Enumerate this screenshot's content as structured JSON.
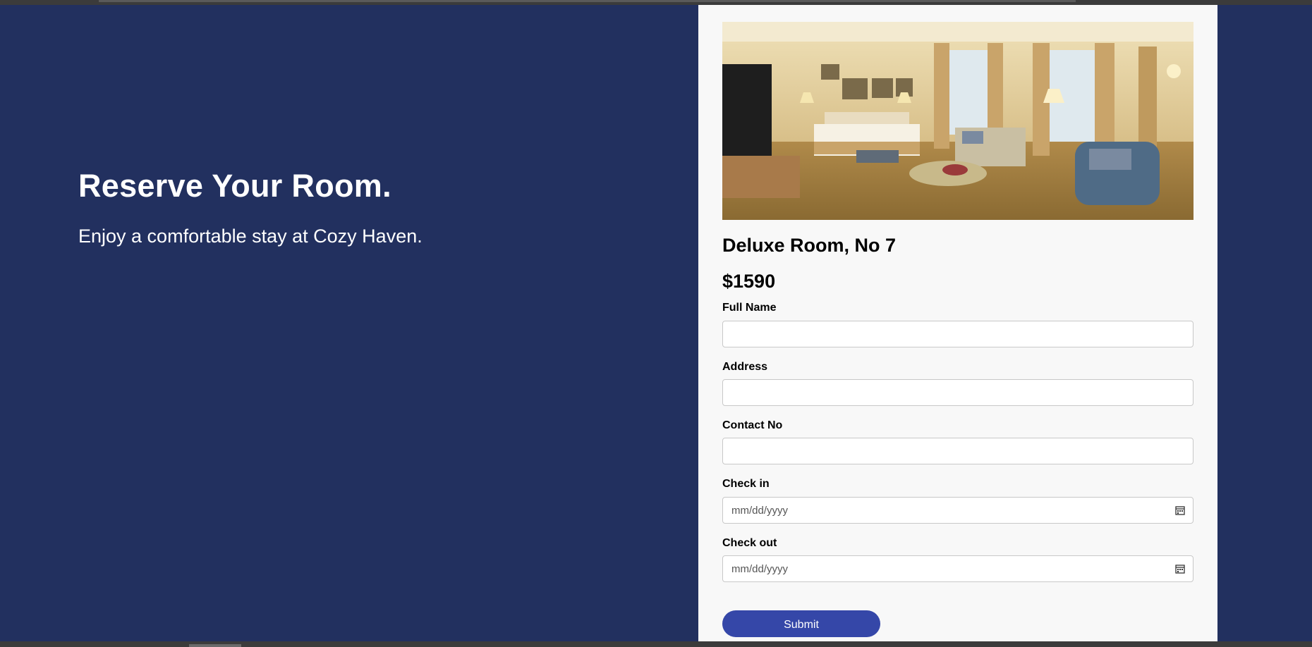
{
  "hero": {
    "title": "Reserve Your Room.",
    "subtitle": "Enjoy a comfortable stay at Cozy Haven."
  },
  "room": {
    "name": "Deluxe Room, No 7",
    "price": "$1590"
  },
  "form": {
    "full_name": {
      "label": "Full Name",
      "value": ""
    },
    "address": {
      "label": "Address",
      "value": ""
    },
    "contact": {
      "label": "Contact No",
      "value": ""
    },
    "check_in": {
      "label": "Check in",
      "placeholder": "mm/dd/yyyy"
    },
    "check_out": {
      "label": "Check out",
      "placeholder": "mm/dd/yyyy"
    },
    "submit_label": "Submit"
  },
  "icons": {
    "check_in_icon": "calendar-icon",
    "check_out_icon": "calendar-icon"
  },
  "colors": {
    "background": "#22305f",
    "panel": "#f8f8f8",
    "button": "#3547a8"
  }
}
